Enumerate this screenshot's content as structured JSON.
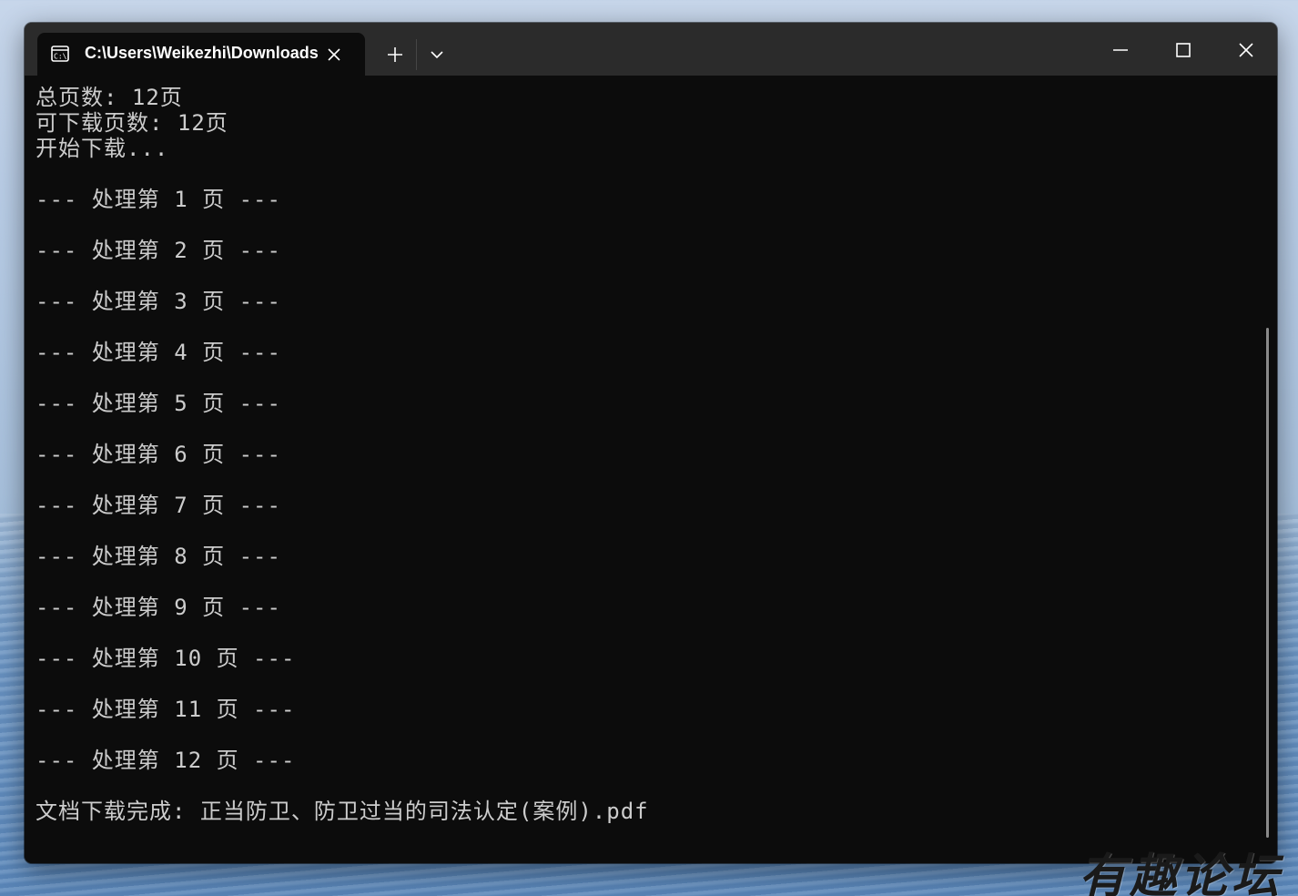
{
  "tab": {
    "title": "C:\\Users\\Weikezhi\\Downloads",
    "icon": "cmd-icon"
  },
  "tabbar": {
    "new_tab_icon": "plus-icon",
    "dropdown_icon": "chevron-down-icon"
  },
  "window_controls": {
    "minimize_icon": "minimize-icon",
    "maximize_icon": "maximize-icon",
    "close_icon": "close-icon"
  },
  "console": {
    "lines": [
      "总页数: 12页",
      "可下载页数: 12页",
      "开始下载...",
      "",
      "--- 处理第 1 页 ---",
      "",
      "--- 处理第 2 页 ---",
      "",
      "--- 处理第 3 页 ---",
      "",
      "--- 处理第 4 页 ---",
      "",
      "--- 处理第 5 页 ---",
      "",
      "--- 处理第 6 页 ---",
      "",
      "--- 处理第 7 页 ---",
      "",
      "--- 处理第 8 页 ---",
      "",
      "--- 处理第 9 页 ---",
      "",
      "--- 处理第 10 页 ---",
      "",
      "--- 处理第 11 页 ---",
      "",
      "--- 处理第 12 页 ---",
      "",
      "文档下载完成: 正当防卫、防卫过当的司法认定(案例).pdf"
    ],
    "text_color": "#cccccc",
    "background": "#0c0c0c"
  },
  "watermark": {
    "text": "有趣论坛"
  }
}
